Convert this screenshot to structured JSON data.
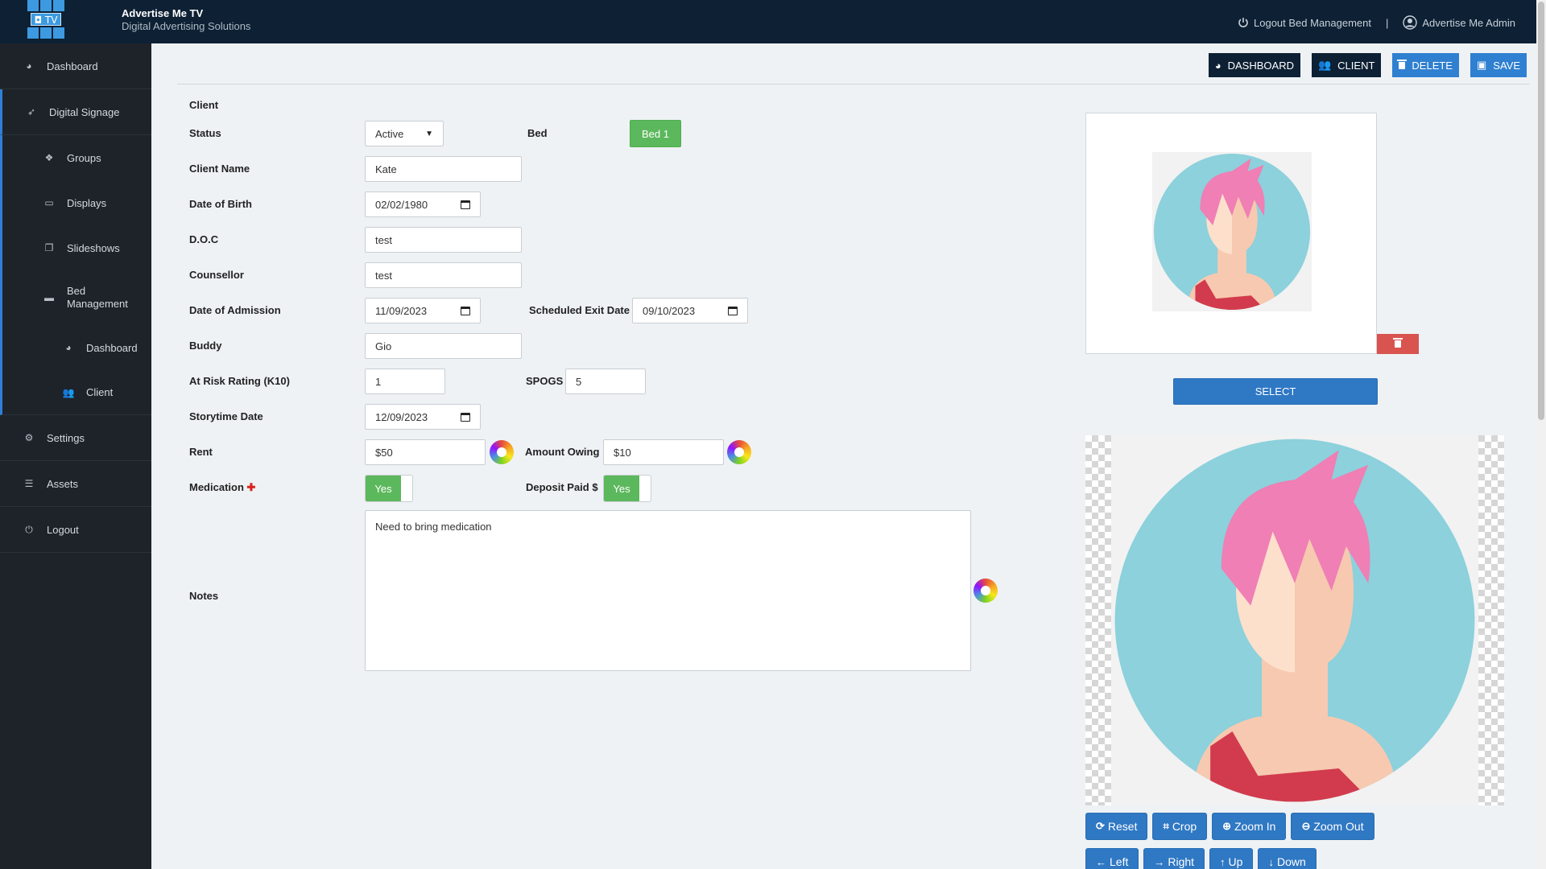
{
  "app": {
    "logo_text": "TV",
    "brand_title": "Advertise Me TV",
    "brand_subtitle": "Digital Advertising Solutions"
  },
  "topbar": {
    "logout_label": "Logout Bed Management",
    "separator": "|",
    "user_label": "Advertise Me Admin"
  },
  "sidebar": {
    "items": [
      {
        "label": "Dashboard",
        "icon": "gauge-icon"
      },
      {
        "label": "Digital Signage",
        "icon": "rocket-icon"
      },
      {
        "label": "Groups",
        "icon": "cubes-icon"
      },
      {
        "label": "Displays",
        "icon": "monitor-icon"
      },
      {
        "label": "Slideshows",
        "icon": "copy-icon"
      },
      {
        "label_line1": "Bed",
        "label_line2": "Management",
        "icon": "bed-icon"
      },
      {
        "label": "Dashboard",
        "icon": "gauge-icon"
      },
      {
        "label": "Client",
        "icon": "users-icon"
      },
      {
        "label": "Settings",
        "icon": "gear-icon"
      },
      {
        "label": "Assets",
        "icon": "database-icon"
      },
      {
        "label": "Logout",
        "icon": "power-icon"
      }
    ]
  },
  "actions": {
    "dashboard": "DASHBOARD",
    "client": "CLIENT",
    "delete": "DELETE",
    "save": "SAVE"
  },
  "form": {
    "section_title": "Client",
    "status_label": "Status",
    "status_value": "Active",
    "bed_label": "Bed",
    "bed_value": "Bed 1",
    "client_name_label": "Client Name",
    "client_name_value": "Kate",
    "dob_label": "Date of Birth",
    "dob_value": "02/02/1980",
    "doc_label": "D.O.C",
    "doc_value": "test",
    "counsellor_label": "Counsellor",
    "counsellor_value": "test",
    "admission_label": "Date of Admission",
    "admission_value": "11/09/2023",
    "exit_label": "Scheduled Exit Date",
    "exit_value": "09/10/2023",
    "buddy_label": "Buddy",
    "buddy_value": "Gio",
    "risk_label": "At Risk Rating (K10)",
    "risk_value": "1",
    "spogs_label": "SPOGS",
    "spogs_value": "5",
    "storytime_label": "Storytime Date",
    "storytime_value": "12/09/2023",
    "rent_label": "Rent",
    "rent_value": "$50",
    "owing_label": "Amount Owing",
    "owing_value": "$10",
    "medication_label": "Medication",
    "medication_mark": "✚",
    "medication_toggle": "Yes",
    "deposit_label": "Deposit Paid $",
    "deposit_toggle": "Yes",
    "notes_label": "Notes",
    "notes_value": "Need to bring medication"
  },
  "photo": {
    "select_label": "SELECT",
    "tools_row1": [
      "Reset",
      "Crop",
      "Zoom In",
      "Zoom Out"
    ],
    "tools_row2": [
      "Left",
      "Right",
      "Up",
      "Down"
    ]
  },
  "colors": {
    "topbar": "#0d2034",
    "sidebar": "#1d2328",
    "primary": "#2f78c4",
    "success": "#5cb85c",
    "danger": "#d9534f",
    "avatar_bg": "#8cd1dc",
    "avatar_hair": "#ef7fb4",
    "avatar_top": "#d23b4e"
  }
}
